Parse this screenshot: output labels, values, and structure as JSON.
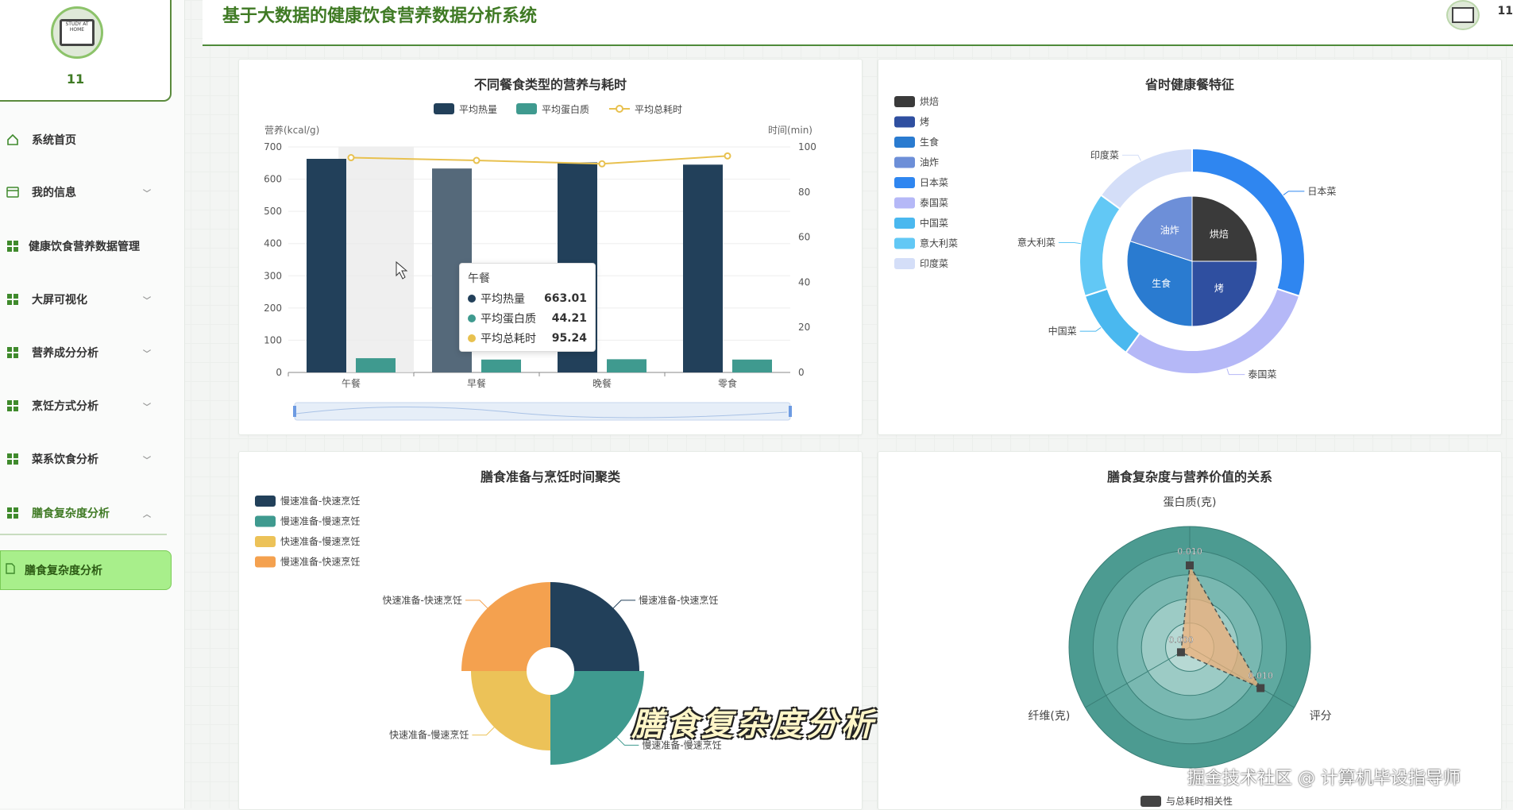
{
  "app": {
    "title": "基于大数据的健康饮食营养数据分析系统",
    "username": "11"
  },
  "sidebar": {
    "profile_name": "11",
    "avatar_text": "STUDY AT HOME",
    "items": [
      {
        "label": "系统首页",
        "icon": "home-icon"
      },
      {
        "label": "我的信息",
        "icon": "id-card-icon"
      },
      {
        "label": "健康饮食营养数据管理",
        "icon": "grid-icon"
      },
      {
        "label": "大屏可视化",
        "icon": "grid-icon"
      },
      {
        "label": "营养成分分析",
        "icon": "grid-icon"
      },
      {
        "label": "烹饪方式分析",
        "icon": "grid-icon"
      },
      {
        "label": "菜系饮食分析",
        "icon": "grid-icon"
      },
      {
        "label": "膳食复杂度分析",
        "icon": "grid-icon"
      }
    ],
    "active_sub": "膳食复杂度分析"
  },
  "panels": {
    "p1": {
      "title": "不同餐食类型的营养与耗时",
      "tooltip": {
        "title": "午餐",
        "rows": [
          {
            "label": "平均热量",
            "value": "663.01",
            "color": "#22405a"
          },
          {
            "label": "平均蛋白质",
            "value": "44.21",
            "color": "#3f9a8f"
          },
          {
            "label": "平均总耗时",
            "value": "95.24",
            "color": "#e8c14f"
          }
        ]
      }
    },
    "p2": {
      "title": "省时健康餐特征"
    },
    "p3": {
      "title": "膳食准备与烹饪时间聚类"
    },
    "p4": {
      "title": "膳食复杂度与营养价值的关系"
    }
  },
  "chart_data": [
    {
      "type": "bar",
      "title": "不同餐食类型的营养与耗时",
      "categories": [
        "午餐",
        "早餐",
        "晚餐",
        "零食"
      ],
      "ylabel": "营养(kcal/g)",
      "y2label": "时间(min)",
      "ylim": [
        0,
        700
      ],
      "y2lim": [
        0,
        100
      ],
      "yticks": [
        "0",
        "100",
        "200",
        "300",
        "400",
        "500",
        "600",
        "700"
      ],
      "y2ticks": [
        "0",
        "20",
        "40",
        "60",
        "80",
        "100"
      ],
      "series": [
        {
          "name": "平均热量",
          "type": "bar",
          "values": [
            663.01,
            633,
            652,
            645
          ],
          "color": "#22405a"
        },
        {
          "name": "平均蛋白质",
          "type": "bar",
          "values": [
            44.21,
            40,
            41,
            40
          ],
          "color": "#3f9a8f"
        },
        {
          "name": "平均总耗时",
          "type": "line",
          "axis": "right",
          "values": [
            95.24,
            94,
            92.5,
            96
          ],
          "color": "#e8c14f"
        }
      ],
      "legend": "top-center"
    },
    {
      "type": "pie",
      "title": "省时健康餐特征",
      "legend": [
        "烘焙",
        "烤",
        "生食",
        "油炸",
        "日本菜",
        "泰国菜",
        "中国菜",
        "意大利菜",
        "印度菜"
      ],
      "legend_colors": [
        "#3a3a3a",
        "#2f4fa0",
        "#2a7bd0",
        "#6d8fd8",
        "#2f86f0",
        "#b5b8f7",
        "#4ab8ef",
        "#62c8f5",
        "#d4def8"
      ],
      "inner": [
        {
          "name": "烘焙",
          "value": 25
        },
        {
          "name": "烤",
          "value": 25
        },
        {
          "name": "生食",
          "value": 30
        },
        {
          "name": "油炸",
          "value": 20
        }
      ],
      "outer": [
        {
          "name": "日本菜",
          "value": 30
        },
        {
          "name": "泰国菜",
          "value": 30
        },
        {
          "name": "中国菜",
          "value": 10
        },
        {
          "name": "意大利菜",
          "value": 15
        },
        {
          "name": "印度菜",
          "value": 15
        }
      ]
    },
    {
      "type": "pie",
      "title": "膳食准备与烹饪时间聚类",
      "legend": [
        "慢速准备-快速烹饪",
        "慢速准备-慢速烹饪",
        "快速准备-慢速烹饪",
        "快速准备-快速烹饪"
      ],
      "legend_labels_shown": [
        "慢速准备-快速烹饪",
        "慢速准备-慢速烹饪",
        "快速准备-慢速烹饪",
        "慢速准备-快速烹饪"
      ],
      "slices": [
        {
          "name": "慢速准备-快速烹饪",
          "value": 25,
          "color": "#22405a"
        },
        {
          "name": "慢速准备-慢速烹饪",
          "value": 25,
          "color": "#3f9a8f"
        },
        {
          "name": "快速准备-慢速烹饪",
          "value": 25,
          "color": "#ecc258"
        },
        {
          "name": "快速准备-快速烹饪",
          "value": 25,
          "color": "#f4a14f"
        }
      ]
    },
    {
      "type": "radar",
      "title": "膳食复杂度与营养价值的关系",
      "indicators": [
        "蛋白质(克)",
        "评分",
        "纤维(克)"
      ],
      "series": [
        {
          "name": "与总耗时相关性",
          "values": [
            0.01,
            0.01,
            0.0
          ],
          "labels": [
            "0.010",
            "0.010",
            "0.000"
          ]
        }
      ]
    }
  ],
  "overlay": {
    "caption": "膳食复杂度分析",
    "watermark": "掘金技术社区 @ 计算机毕设指导师"
  }
}
